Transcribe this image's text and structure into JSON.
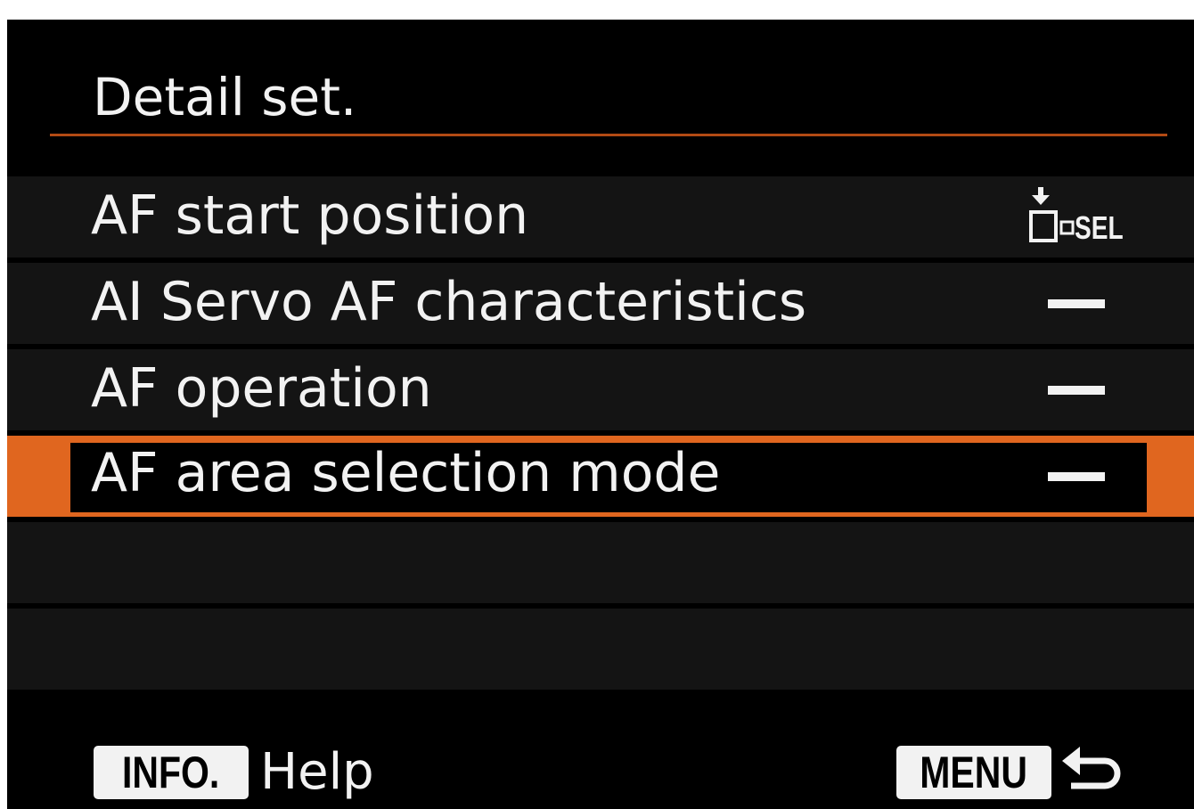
{
  "title": "Detail set.",
  "rows": [
    {
      "label": "AF start position",
      "value_icon": "af-point-select-sel-icon",
      "value_text": "SEL"
    },
    {
      "label": "AI Servo AF characteristics",
      "value_icon": "dash-icon"
    },
    {
      "label": "AF operation",
      "value_icon": "dash-icon"
    },
    {
      "label": "AF area selection mode",
      "value_icon": "dash-icon",
      "selected": true
    }
  ],
  "footer": {
    "info_badge": "INFO.",
    "help_label": "Help",
    "menu_badge": "MENU",
    "back_icon": "return-arrow-icon"
  },
  "colors": {
    "background": "#000000",
    "row_background": "#141414",
    "accent_orange": "#e0661f",
    "title_rule": "#b24a14",
    "text": "#f2f2f2"
  }
}
